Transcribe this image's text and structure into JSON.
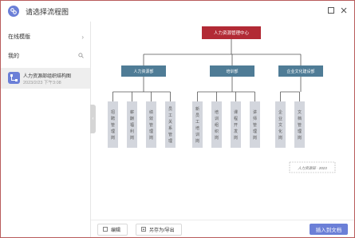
{
  "window": {
    "title": "请选择流程图",
    "icons": [
      "app-logo-icon",
      "maximize-icon",
      "close-icon"
    ]
  },
  "sidebar": {
    "online_templates_label": "在线模版",
    "mine_label": "我的",
    "template": {
      "name": "人力资源部组织结构图",
      "time": "2023/2/23 下午3:08"
    }
  },
  "org_chart": {
    "root": "人力资源管理中心",
    "departments": [
      {
        "name": "人力资源部",
        "children": [
          "招聘管理岗",
          "薪酬福利岗",
          "绩效管理岗",
          "员工关系管理"
        ]
      },
      {
        "name": "培训部",
        "children": [
          "新员工培训岗",
          "培训组织岗",
          "课程开发岗",
          "讲师管理岗"
        ]
      },
      {
        "name": "企业文化建设部",
        "children": [
          "企业文化岗",
          "文档管理岗"
        ]
      }
    ],
    "note": "人力资源部 · 2023"
  },
  "colors": {
    "root_fill": "#b22a35",
    "dept_fill": "#4f7c96",
    "leaf_fill": "#d3d6dd",
    "accent": "#6b7fd7",
    "window_border": "#b85c5c"
  },
  "footer": {
    "edit_label": "编辑",
    "save_export_label": "另存为/导出",
    "insert_label": "插入到文档"
  }
}
